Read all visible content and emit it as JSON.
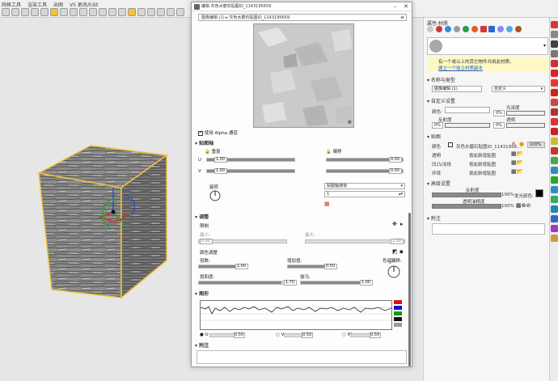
{
  "toolbar": {
    "menu": [
      "网格工具",
      "渲染工具",
      "出图",
      "V5 更改/Edit"
    ]
  },
  "dialog": {
    "title": "编辑 灰色水磨石贴图ID_1143195659",
    "crumb": "图像编辑 (1)  ▸ 灰色水磨石贴图ID_1143195659",
    "use_alpha_label": "使用 Alpha 通道",
    "mapping_header": "贴图轴",
    "repeat_label": "重复",
    "offset_label": "偏移",
    "u_label": "U",
    "v_label": "V",
    "repeat_u": "1.00",
    "repeat_v": "1.00",
    "offset_u": "0.00",
    "offset_v": "0.00",
    "rotation_label": "旋转",
    "channel_select": "贴图轴通道",
    "channel_value": "1",
    "adjust_header": "调整",
    "limit_label": "限制",
    "min_label": "最小:",
    "max_label": "最大:",
    "min_value": "0.00",
    "max_value": "1.00",
    "color_adjust_label": "颜色调整",
    "multiply_label": "倍数:",
    "multiply_value": "1.00",
    "saturation_label": "增加值:",
    "saturation_value": "0.50",
    "hue_label": "色调偏移:",
    "hue_value": "0°",
    "contrast_label": "饱和度:",
    "contrast_value": "1.70",
    "gamma_label": "伽马:",
    "gamma_value": "1.00",
    "graph_header": "图形",
    "graph_u_label": "U",
    "graph_u_value": "0.50",
    "graph_v_label": "V",
    "graph_v_value": "0.50",
    "graph_w_label": "W",
    "graph_w_value": "0.50",
    "notes_header": "附注"
  },
  "panel": {
    "title": "属性:材质",
    "warning_line1": "有一个或以上的其它物件共用此材质。",
    "warning_line2": "建立一个独立材质副本",
    "name_type_header": "名称与类型",
    "name_value": "图像编辑 (1)",
    "type_value": "自定义",
    "custom_header": "自定义设置",
    "color_label": "颜色:",
    "gloss_label": "光泽度",
    "gloss_value": "0%",
    "reflect_label": "反射度",
    "reflect_value": "0%",
    "transp_label": "透明",
    "transp_value": "0%",
    "texture_header": "贴图",
    "tex_color_label": "颜色",
    "tex_color_value": "灰色水磨石贴图ID_11431956...",
    "tex_color_pct": "100%",
    "tex_transp_label": "透明",
    "tex_transp_value": "按此新增贴图",
    "tex_bump_label": "凹凸/法线",
    "tex_bump_value": "按此新增贴图",
    "tex_env_label": "环境",
    "tex_env_value": "按此新增贴图",
    "advanced_header": "高级设置",
    "reflect2_label": "反射度",
    "reflect2_value": "100%",
    "emission_label": "发光颜色:",
    "fresnel_label": "透明油精度",
    "fresnel_value": "100%",
    "notes_header": "附注"
  },
  "colors": {
    "accent": "#f3c23a",
    "warning_bg": "#fff8c4",
    "link": "#2a62b8"
  }
}
